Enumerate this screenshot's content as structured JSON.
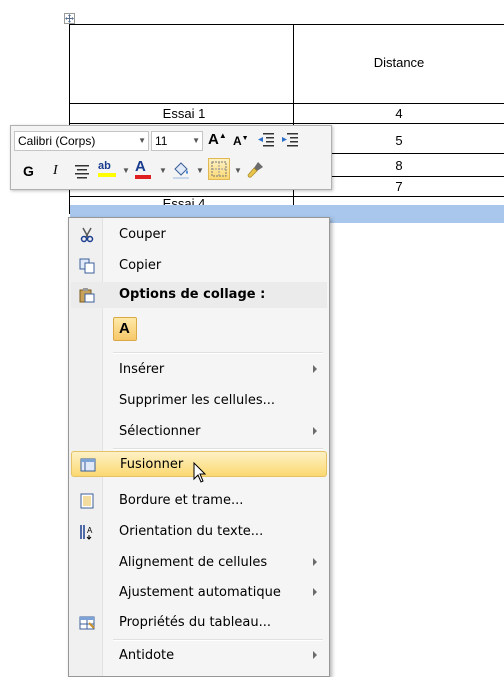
{
  "table": {
    "header": {
      "col2": "Distance"
    },
    "rows": [
      {
        "col1": "Essai 1",
        "col2": "4"
      },
      {
        "col1": "",
        "col2": "5"
      },
      {
        "col1": "",
        "col2": "8"
      },
      {
        "col1": "Essai 4",
        "col2": "7"
      }
    ]
  },
  "mini_toolbar": {
    "font_name": "Calibri (Corps)",
    "font_size": "11",
    "grow_font": "A",
    "shrink_font": "A",
    "bold": "G",
    "italic": "I",
    "highlight_label": "ab",
    "font_color_label": "A",
    "highlight_color": "#ffff00",
    "font_color": "#e02020"
  },
  "context_menu": {
    "items": [
      {
        "label": "Couper",
        "icon": "scissors-icon"
      },
      {
        "label": "Copier",
        "icon": "copy-icon"
      },
      {
        "label": "Options de collage :",
        "icon": "paste-icon"
      },
      {
        "paste_option": "A"
      },
      {
        "label": "Insérer",
        "submenu": true
      },
      {
        "label": "Supprimer les cellules..."
      },
      {
        "label": "Sélectionner",
        "submenu": true
      },
      {
        "label": "Fusionner",
        "icon": "merge-cells-icon",
        "highlighted": true
      },
      {
        "label": "Bordure et trame...",
        "icon": "borders-shading-icon"
      },
      {
        "label": "Orientation du texte...",
        "icon": "text-direction-icon"
      },
      {
        "label": "Alignement de cellules",
        "submenu": true
      },
      {
        "label": "Ajustement automatique",
        "submenu": true
      },
      {
        "label": "Propriétés du tableau...",
        "icon": "table-properties-icon"
      },
      {
        "label": "Antidote",
        "submenu": true
      }
    ]
  },
  "colors": {
    "selection": "#a9c7ec",
    "menu_highlight": "#fbd871"
  }
}
